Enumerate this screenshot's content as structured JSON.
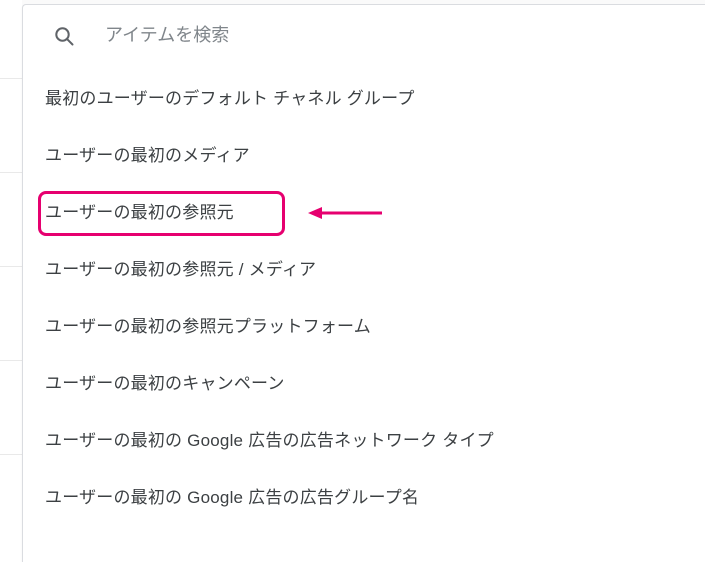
{
  "search": {
    "placeholder": "アイテムを検索"
  },
  "list": {
    "items": [
      {
        "label": "最初のユーザーのデフォルト チャネル グループ"
      },
      {
        "label": "ユーザーの最初のメディア"
      },
      {
        "label": "ユーザーの最初の参照元"
      },
      {
        "label": "ユーザーの最初の参照元 / メディア"
      },
      {
        "label": "ユーザーの最初の参照元プラットフォーム"
      },
      {
        "label": "ユーザーの最初のキャンペーン"
      },
      {
        "label": "ユーザーの最初の Google 広告の広告ネットワーク タイプ"
      },
      {
        "label": "ユーザーの最初の Google 広告の広告グループ名"
      }
    ]
  },
  "annotation": {
    "highlight_index": 2,
    "highlight_color": "#e6006f"
  }
}
